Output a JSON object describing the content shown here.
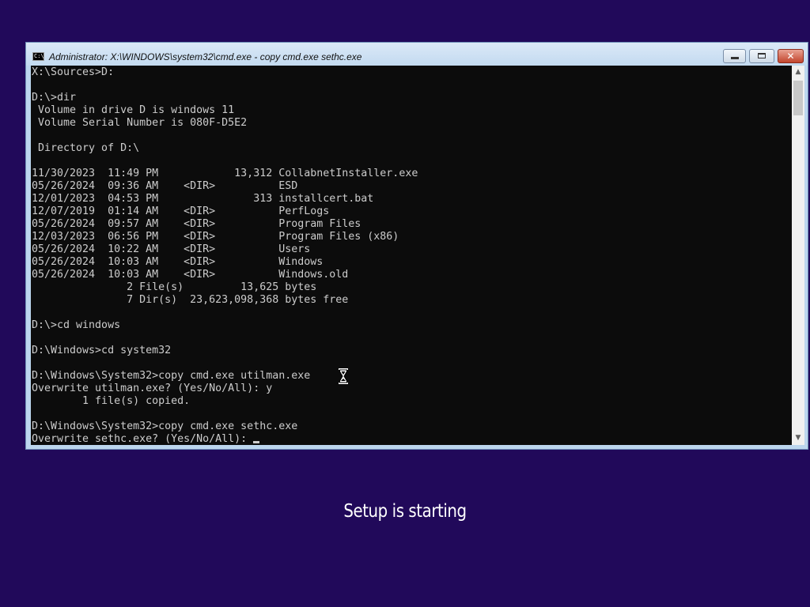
{
  "window": {
    "title": "Administrator: X:\\WINDOWS\\system32\\cmd.exe - copy  cmd.exe sethc.exe",
    "icon_label": "C:\\",
    "buttons": {
      "minimize_icon": "minimize-icon",
      "maximize_icon": "maximize-icon",
      "close_icon": "close-icon",
      "close_glyph": "✕"
    }
  },
  "console": {
    "lines": [
      "X:\\Sources>D:",
      "",
      "D:\\>dir",
      " Volume in drive D is windows 11",
      " Volume Serial Number is 080F-D5E2",
      "",
      " Directory of D:\\",
      "",
      "11/30/2023  11:49 PM            13,312 CollabnetInstaller.exe",
      "05/26/2024  09:36 AM    <DIR>          ESD",
      "12/01/2023  04:53 PM               313 installcert.bat",
      "12/07/2019  01:14 AM    <DIR>          PerfLogs",
      "05/26/2024  09:57 AM    <DIR>          Program Files",
      "12/03/2023  06:56 PM    <DIR>          Program Files (x86)",
      "05/26/2024  10:22 AM    <DIR>          Users",
      "05/26/2024  10:03 AM    <DIR>          Windows",
      "05/26/2024  10:03 AM    <DIR>          Windows.old",
      "               2 File(s)         13,625 bytes",
      "               7 Dir(s)  23,623,098,368 bytes free",
      "",
      "D:\\>cd windows",
      "",
      "D:\\Windows>cd system32",
      "",
      "D:\\Windows\\System32>copy cmd.exe utilman.exe",
      "Overwrite utilman.exe? (Yes/No/All): y",
      "        1 file(s) copied.",
      "",
      "D:\\Windows\\System32>copy cmd.exe sethc.exe",
      "Overwrite sethc.exe? (Yes/No/All): "
    ]
  },
  "scrollbar": {
    "up_glyph": "▲",
    "down_glyph": "▼"
  },
  "status": {
    "setup_text": "Setup is starting"
  },
  "colors": {
    "desktop_background": "#21095a",
    "console_background": "#0c0c0c",
    "console_text": "#cccccc",
    "window_frame": "#bcd6ee",
    "close_button": "#c2452d"
  }
}
